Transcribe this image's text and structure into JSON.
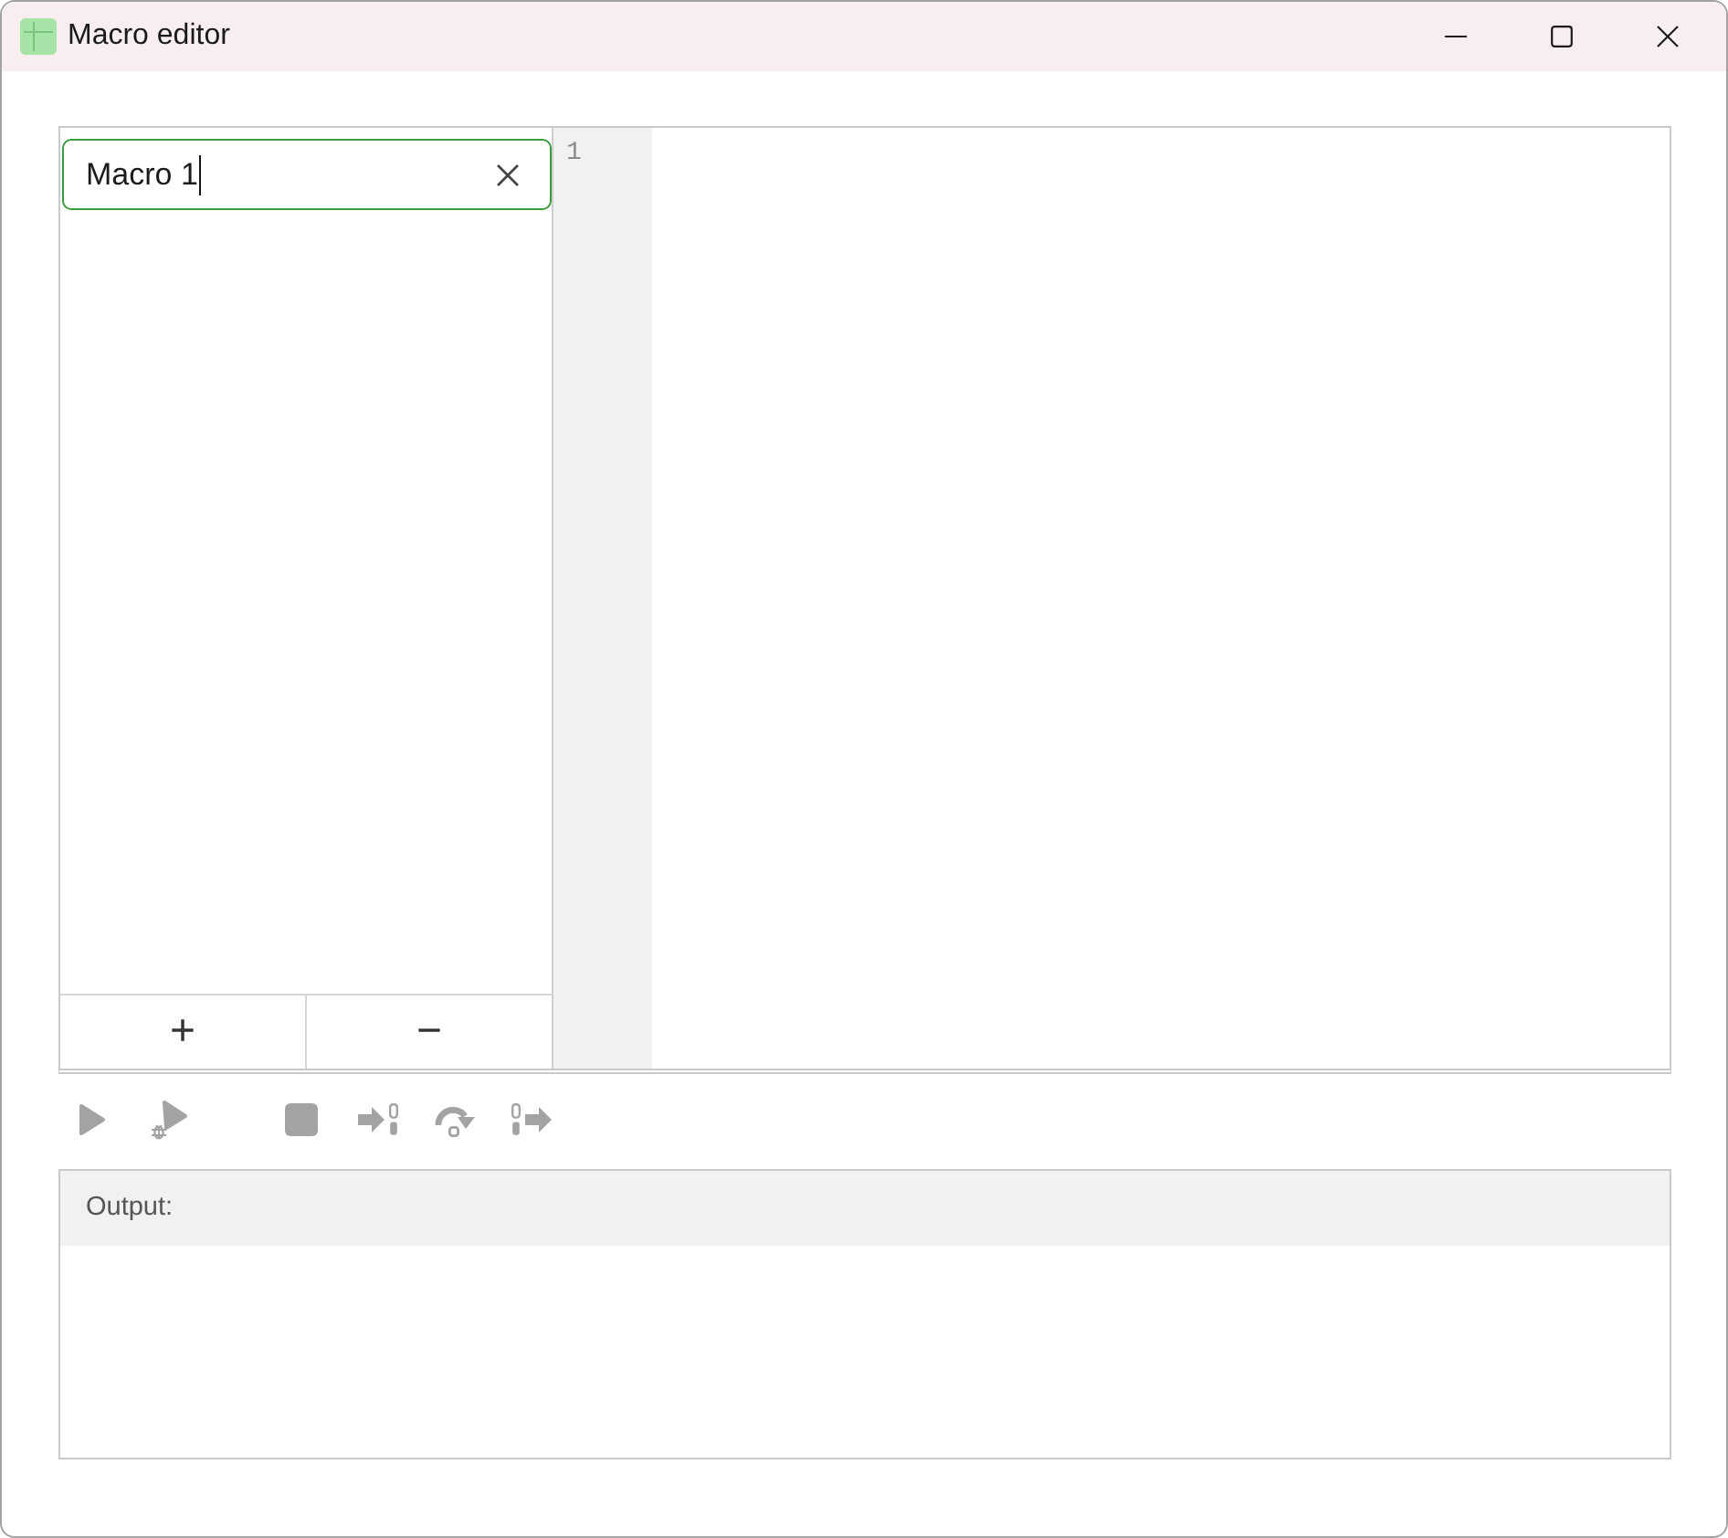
{
  "window": {
    "title": "Macro editor"
  },
  "macros": {
    "name_field": {
      "value": "Macro 1",
      "focused": true
    },
    "add_button": "+",
    "remove_button": "−"
  },
  "editor": {
    "line_numbers": [
      "1"
    ]
  },
  "toolbar": [
    {
      "kind": "run",
      "disabled": true
    },
    {
      "kind": "debug",
      "disabled": true
    },
    {
      "kind": "stop",
      "disabled": true
    },
    {
      "kind": "step_into",
      "disabled": true
    },
    {
      "kind": "step_over",
      "disabled": true
    },
    {
      "kind": "step_out",
      "disabled": true
    }
  ],
  "output": {
    "label": "Output:"
  }
}
